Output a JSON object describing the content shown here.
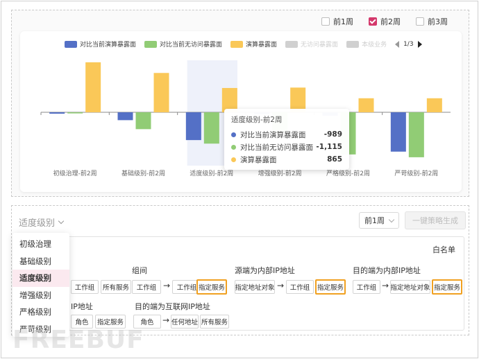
{
  "week_toggles": [
    {
      "label": "前1周",
      "checked": false
    },
    {
      "label": "前2周",
      "checked": true
    },
    {
      "label": "前3周",
      "checked": false
    }
  ],
  "legend": {
    "items": [
      {
        "label": "对比当前演算暴露面",
        "color": "#5470c6",
        "faded": false
      },
      {
        "label": "对比当前无访问暴露面",
        "color": "#91cc75",
        "faded": false
      },
      {
        "label": "演算暴露面",
        "color": "#fac858",
        "faded": false
      },
      {
        "label": "无访问暴露面",
        "color": "#d0d0d0",
        "faded": true
      },
      {
        "label": "本级业务",
        "color": "#d0d0d0",
        "faded": true
      }
    ],
    "page": "1/3"
  },
  "chart_data": {
    "type": "bar",
    "categories": [
      "初级治理-前2周",
      "基础级别-前2周",
      "适度级别-前2周",
      "增强级别-前2周",
      "严格级别-前2周",
      "严苛级别-前2周"
    ],
    "series": [
      {
        "name": "对比当前演算暴露面",
        "color": "#5470c6",
        "values": [
          -50,
          -280,
          -989,
          -60,
          -120,
          -1400
        ]
      },
      {
        "name": "对比当前无访问暴露面",
        "color": "#91cc75",
        "values": [
          -40,
          -600,
          -1115,
          -700,
          -1500,
          -1600
        ]
      },
      {
        "name": "演算暴露面",
        "color": "#fac858",
        "values": [
          1780,
          1400,
          865,
          880,
          500,
          500
        ]
      }
    ],
    "ylim": [
      -1800,
      1900
    ],
    "highlighted_category": 2
  },
  "tooltip": {
    "title": "适度级别-前2周",
    "rows": [
      {
        "name": "对比当前演算暴露面",
        "value": "-989",
        "color": "#5470c6"
      },
      {
        "name": "对比当前无访问暴露面",
        "value": "-1,115",
        "color": "#91cc75"
      },
      {
        "name": "演算暴露面",
        "value": "865",
        "color": "#fac858"
      }
    ]
  },
  "bottom": {
    "level_select": "适度级别",
    "week_select": "前1周",
    "generate_button": "一键策略生成",
    "whitelist": "白名单",
    "rules": {
      "group_title": "组间",
      "source_title": "源端为内部IP地址",
      "dest_title": "目的端为内部IP地址",
      "ip_title_partial": "IP地址",
      "internet_title": "目的端为互联网IP地址",
      "chip_workgroup": "工作组",
      "chip_all_services": "所有服务",
      "chip_specified_service": "指定服务",
      "chip_specified_addr": "指定地址对象",
      "chip_role": "角色",
      "chip_any_addr": "任何地址",
      "arrow": "→"
    },
    "dropdown_items": [
      "初级治理",
      "基础级别",
      "适度级别",
      "增强级别",
      "严格级别",
      "严苛级别"
    ],
    "dropdown_active": 2
  },
  "watermark": "FREEBUF"
}
